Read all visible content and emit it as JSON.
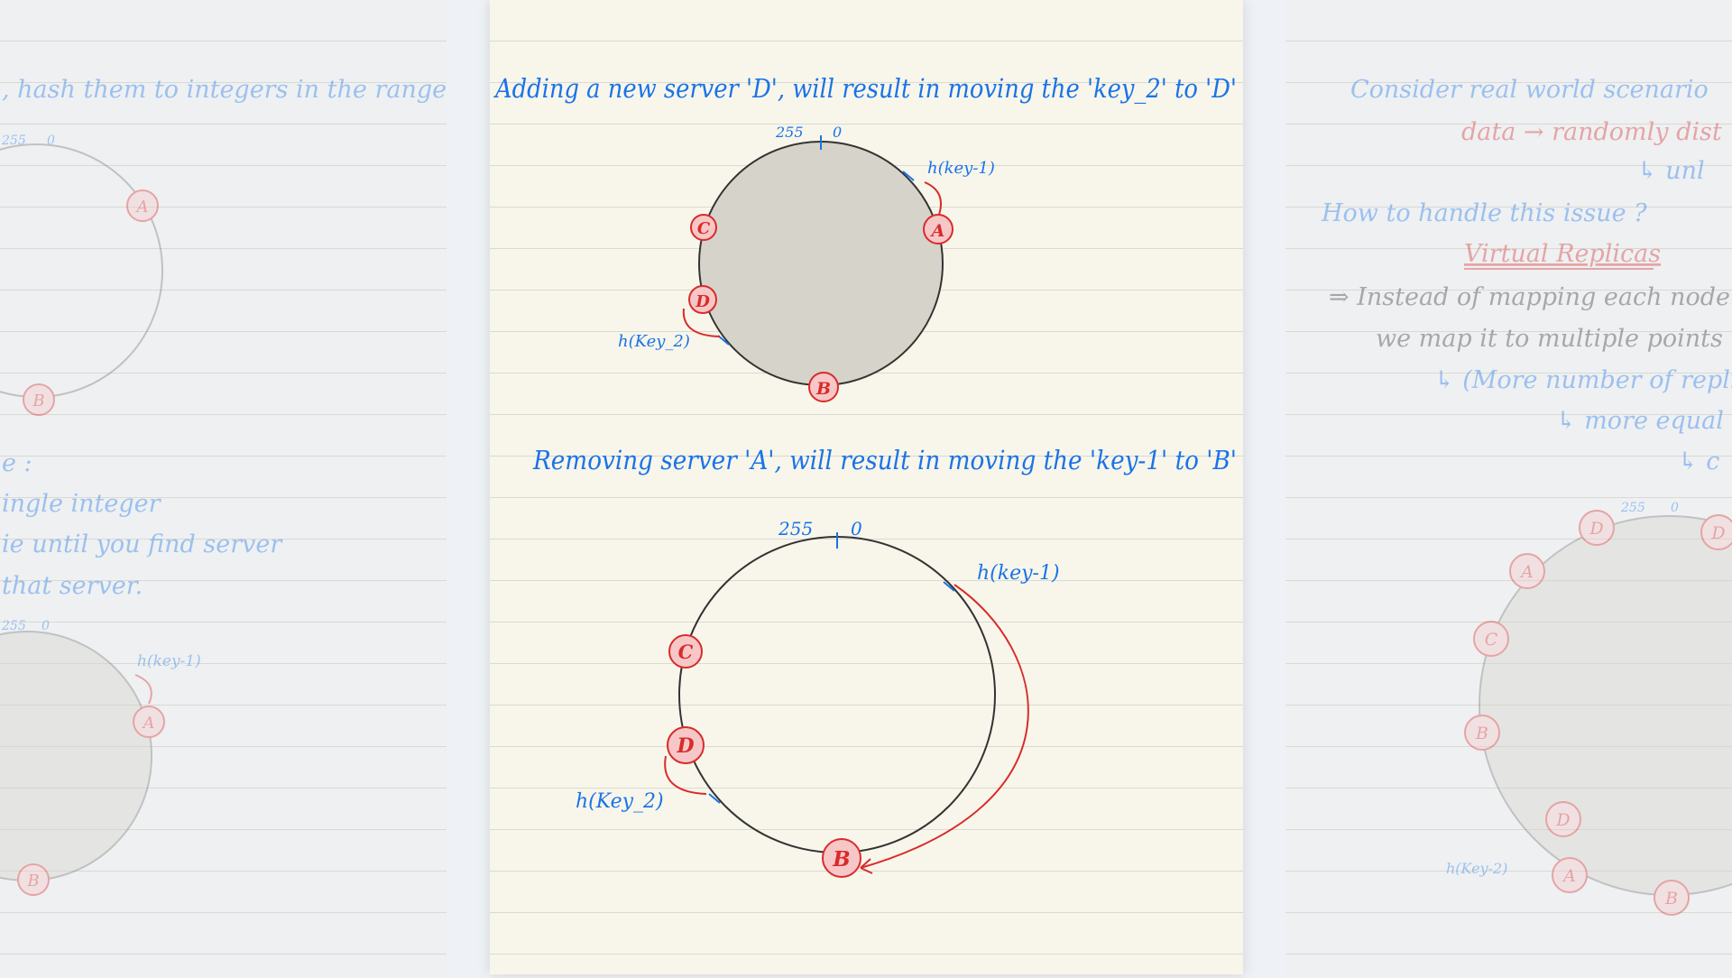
{
  "left_page": {
    "line1": ", hash them to integers in the range.",
    "line2": "e :",
    "line3": "ingle integer",
    "line4": "ie until you find server",
    "line5": "that server.",
    "circle1": {
      "top": "255",
      "zero": "0",
      "node_a": "A",
      "node_b": "B"
    },
    "circle2": {
      "top": "255",
      "zero": "0",
      "key1": "h(key-1)",
      "node_a": "A",
      "node_b": "B"
    }
  },
  "center_page": {
    "heading1": "Adding a new server 'D', will result in moving the 'key_2' to 'D'",
    "heading2": "Removing server 'A', will result in moving the 'key-1' to 'B'",
    "diagram1": {
      "top": "255",
      "zero": "0",
      "key1": "h(key-1)",
      "key2": "h(Key_2)",
      "node_a": "A",
      "node_b": "B",
      "node_c": "C",
      "node_d": "D"
    },
    "diagram2": {
      "top": "255",
      "zero": "0",
      "key1": "h(key-1)",
      "key2": "h(Key_2)",
      "node_b": "B",
      "node_c": "C",
      "node_d": "D"
    }
  },
  "right_page": {
    "line1": "Consider real world scenario",
    "line2": "data → randomly dist",
    "line3": "↳ unl",
    "line4": "How to handle this issue ?",
    "line5": "Virtual Replicas",
    "line6": "⇒ Instead of mapping each node to",
    "line7": "we map it to multiple points",
    "line8": "↳ (More number of replica",
    "line9": "↳ more equal",
    "line10": "↳ c",
    "circle": {
      "top": "255",
      "zero": "0",
      "key2": "h(Key-2)",
      "labels": [
        "D",
        "D",
        "A",
        "C",
        "B",
        "D",
        "A",
        "B"
      ]
    }
  },
  "colors": {
    "ink_blue": "#1a73e8",
    "ink_red": "#d92b2b",
    "node_fill": "#f7c7c7",
    "shade": "#d6d4ca"
  }
}
